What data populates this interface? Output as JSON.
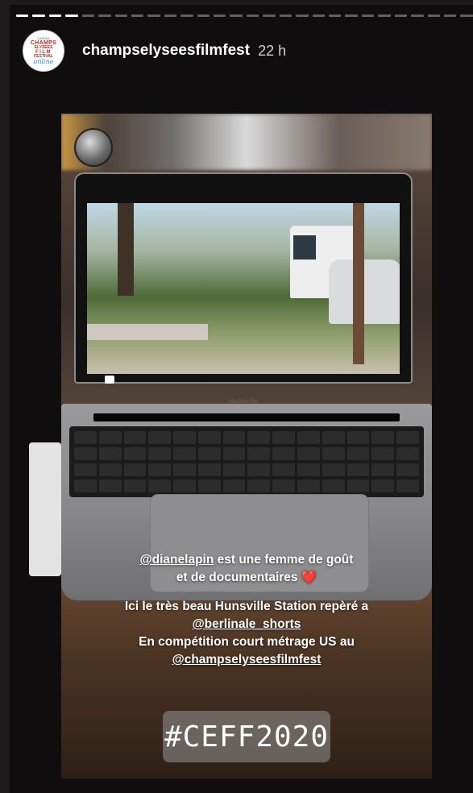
{
  "story": {
    "segments": [
      true,
      true,
      true,
      true,
      false,
      false,
      false,
      false,
      false,
      false,
      false,
      false,
      false,
      false,
      false,
      false,
      false,
      false,
      false,
      false,
      false,
      false,
      false,
      false,
      false,
      false,
      false,
      false
    ],
    "username": "champselyseesfilmfest",
    "time": "22 h",
    "avatar": {
      "line1": "CINEMA",
      "line2": "CHAMPS",
      "line3": "ELYSEES",
      "line4": "FILM",
      "line5": "FESTIVAL",
      "line6": "online"
    }
  },
  "laptop": {
    "brand": "MacBook Pro"
  },
  "caption": {
    "mention1": "@dianelapin",
    "line1_rest": " est une femme de goût",
    "line2": "et de documentaires ❤️",
    "line3": "Ici le très beau Hunsville Station repèré a",
    "mention2": "@berlinale_shorts",
    "line5": "En compétition court métrage US au",
    "mention3": "@champselyseesfilmfest"
  },
  "hashtag": "#CEFF2020"
}
